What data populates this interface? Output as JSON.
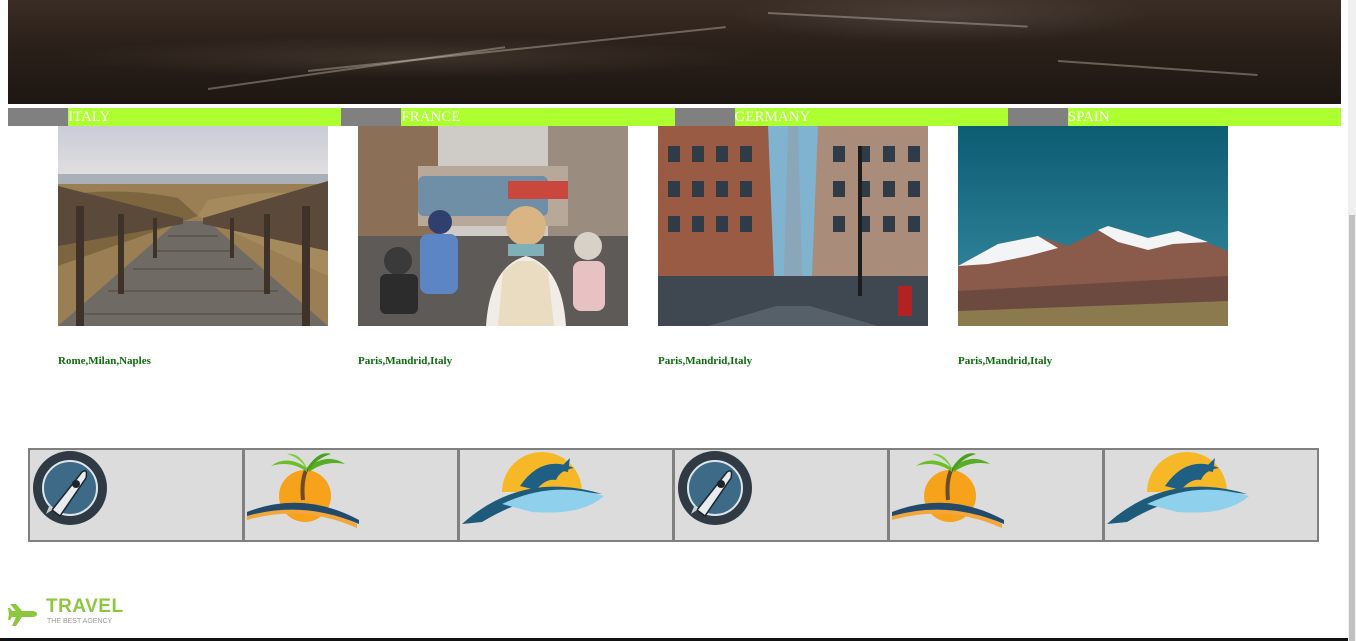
{
  "tabs": [
    {
      "label": "ITALY"
    },
    {
      "label": "FRANCE"
    },
    {
      "label": "GERMANY"
    },
    {
      "label": "SPAIN"
    }
  ],
  "cards": [
    {
      "cities": "Rome,Milan,Naples",
      "image": "wooden-boardwalk-photo"
    },
    {
      "cities": "Paris,Mandrid,Italy",
      "image": "city-street-traveler-photo"
    },
    {
      "cities": "Paris,Mandrid,Italy",
      "image": "skyscraper-street-photo"
    },
    {
      "cities": "Paris,Mandrid,Italy",
      "image": "snowy-mountain-photo"
    }
  ],
  "logos": [
    {
      "icon": "rocket-badge-icon"
    },
    {
      "icon": "palm-island-icon"
    },
    {
      "icon": "dolphin-sun-icon"
    },
    {
      "icon": "rocket-badge-icon"
    },
    {
      "icon": "palm-island-icon"
    },
    {
      "icon": "dolphin-sun-icon"
    }
  ],
  "brand": {
    "name": "TRAVEL",
    "tagline": "THE BEST AGENCY",
    "icon": "airplane-icon"
  },
  "colors": {
    "tab_bg": "#adff2f",
    "tab_accent": "#808080",
    "city_text": "#0b6d0b",
    "logo_bg": "#dcdcdc",
    "brand": "#8dc63f"
  }
}
